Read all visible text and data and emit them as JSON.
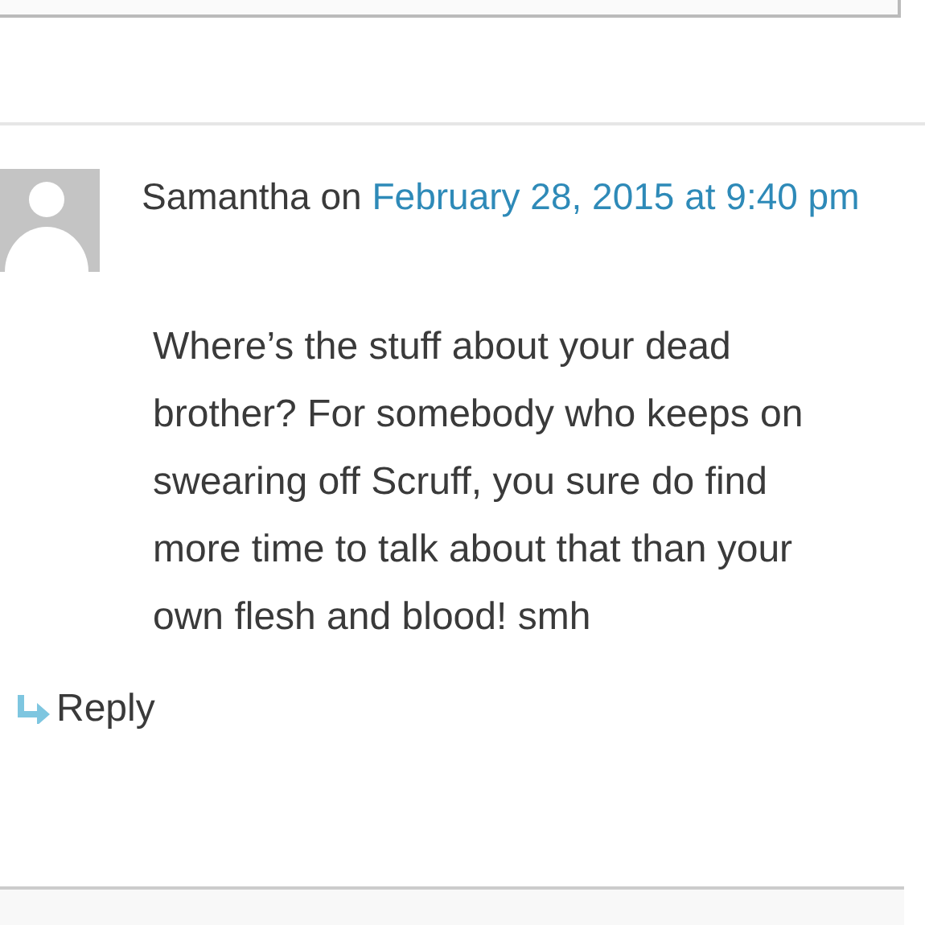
{
  "comment": {
    "author": "Samantha",
    "connector": "on",
    "date": "February 28, 2015 at 9:40 pm",
    "text": "Where’s the stuff about your dead brother? For somebody who keeps on swearing off Scruff, you sure do find more time to talk about that than your own flesh and blood! smh",
    "reply": "Reply"
  }
}
